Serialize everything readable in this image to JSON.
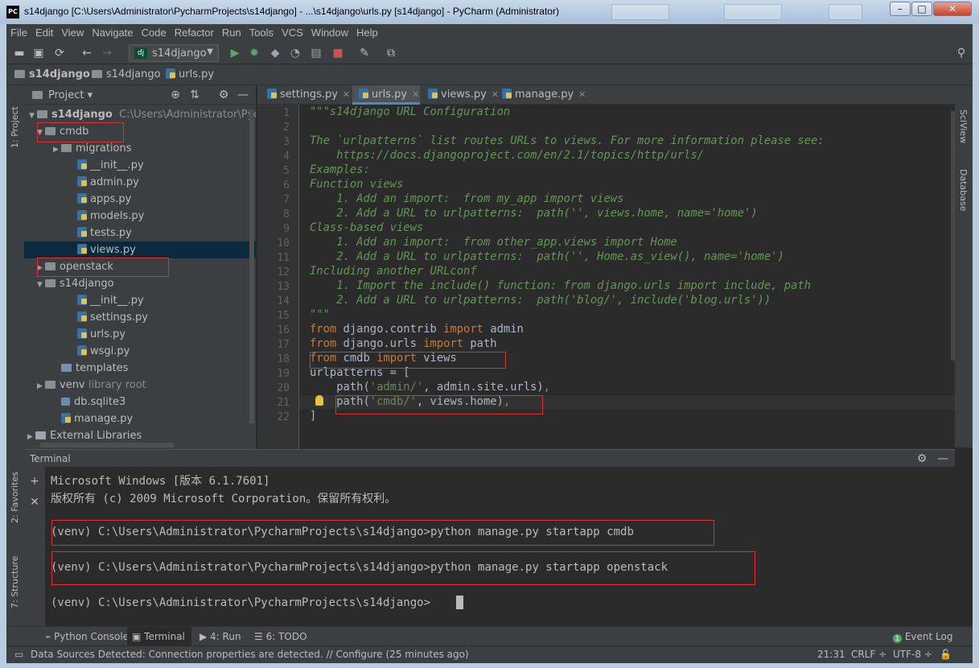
{
  "window": {
    "title": "s14django [C:\\Users\\Administrator\\PycharmProjects\\s14django] - ...\\s14django\\urls.py [s14django] - PyCharm (Administrator)",
    "logo": "PC"
  },
  "menu": [
    "File",
    "Edit",
    "View",
    "Navigate",
    "Code",
    "Refactor",
    "Run",
    "Tools",
    "VCS",
    "Window",
    "Help"
  ],
  "toolbar": {
    "run_config": "s14django",
    "icons": [
      "open-icon",
      "save-icon",
      "sync-icon",
      "back-icon",
      "forward-icon",
      "run-icon",
      "debug-icon",
      "coverage-icon",
      "profile-icon",
      "concurrency-icon",
      "stop-icon",
      "settings-icon",
      "structure-icon",
      "search-icon"
    ]
  },
  "breadcrumb": [
    "s14django",
    "s14django",
    "urls.py"
  ],
  "project_panel": {
    "title": "Project",
    "root_name": "s14django",
    "root_path": "C:\\Users\\Administrator\\Pycharm",
    "rows": [
      {
        "label": "cmdb",
        "kind": "folder"
      },
      {
        "label": "migrations",
        "kind": "folder"
      },
      {
        "label": "__init__.py",
        "kind": "py"
      },
      {
        "label": "admin.py",
        "kind": "py"
      },
      {
        "label": "apps.py",
        "kind": "py"
      },
      {
        "label": "models.py",
        "kind": "py"
      },
      {
        "label": "tests.py",
        "kind": "py"
      },
      {
        "label": "views.py",
        "kind": "py"
      },
      {
        "label": "openstack",
        "kind": "folder"
      },
      {
        "label": "s14django",
        "kind": "folder"
      },
      {
        "label": "__init__.py",
        "kind": "py"
      },
      {
        "label": "settings.py",
        "kind": "py"
      },
      {
        "label": "urls.py",
        "kind": "py"
      },
      {
        "label": "wsgi.py",
        "kind": "py"
      },
      {
        "label": "templates",
        "kind": "folder"
      },
      {
        "label": "venv",
        "kind": "folder",
        "suffix": "library root"
      },
      {
        "label": "db.sqlite3",
        "kind": "db"
      },
      {
        "label": "manage.py",
        "kind": "py"
      },
      {
        "label": "External Libraries",
        "kind": "lib"
      }
    ]
  },
  "editor_tabs": [
    "settings.py",
    "urls.py",
    "views.py",
    "manage.py"
  ],
  "active_tab": "urls.py",
  "code_lines": [
    "\"\"\"s14django URL Configuration",
    "",
    "The `urlpatterns` list routes URLs to views. For more information please see:",
    "    https://docs.djangoproject.com/en/2.1/topics/http/urls/",
    "Examples:",
    "Function views",
    "    1. Add an import:  from my_app import views",
    "    2. Add a URL to urlpatterns:  path('', views.home, name='home')",
    "Class-based views",
    "    1. Add an import:  from other_app.views import Home",
    "    2. Add a URL to urlpatterns:  path('', Home.as_view(), name='home')",
    "Including another URLconf",
    "    1. Import the include() function: from django.urls import include, path",
    "    2. Add a URL to urlpatterns:  path('blog/', include('blog.urls'))",
    "\"\"\"",
    "from django.contrib import admin",
    "from django.urls import path",
    "from cmdb import views",
    "urlpatterns = [",
    "    path('admin/', admin.site.urls),",
    "    path('cmdb/', views.home),",
    "]"
  ],
  "line_numbers": [
    "1",
    "2",
    "3",
    "4",
    "5",
    "6",
    "7",
    "8",
    "9",
    "10",
    "11",
    "12",
    "13",
    "14",
    "15",
    "16",
    "17",
    "18",
    "19",
    "20",
    "21",
    "22"
  ],
  "terminal": {
    "title": "Terminal",
    "lines": [
      "Microsoft Windows [版本 6.1.7601]",
      "版权所有 (c) 2009 Microsoft Corporation。保留所有权利。",
      "(venv) C:\\Users\\Administrator\\PycharmProjects\\s14django>python manage.py startapp cmdb",
      "(venv) C:\\Users\\Administrator\\PycharmProjects\\s14django>python manage.py startapp openstack",
      "(venv) C:\\Users\\Administrator\\PycharmProjects\\s14django>"
    ]
  },
  "left_strip": [
    "1: Project",
    "2: Favorites",
    "7: Structure"
  ],
  "right_strip": [
    "SciView",
    "Database"
  ],
  "bottom_tabs": [
    "Python Console",
    "Terminal",
    "4: Run",
    "6: TODO"
  ],
  "event_log": "Event Log",
  "status": {
    "message": "Data Sources Detected: Connection properties are detected. // Configure (25 minutes ago)",
    "position": "21:31",
    "line_sep": "CRLF ÷",
    "encoding": "UTF-8 ÷"
  },
  "colors": {
    "keyword": "#cc7832",
    "string": "#6a8759",
    "docstring": "#629755",
    "highlight_box": "#e03030"
  }
}
